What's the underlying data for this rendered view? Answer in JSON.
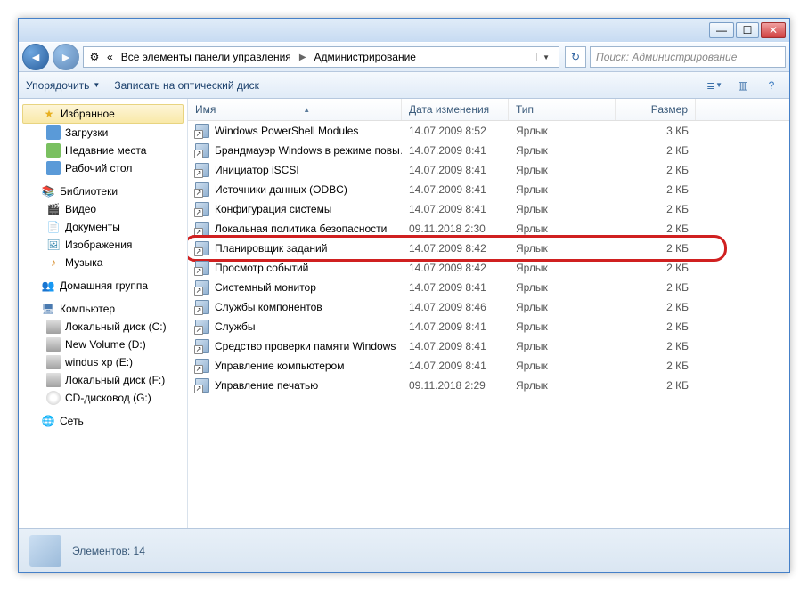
{
  "address": {
    "prefix_icon": "«",
    "seg1": "Все элементы панели управления",
    "seg2": "Администрирование"
  },
  "search": {
    "placeholder": "Поиск: Администрирование"
  },
  "toolbar": {
    "organize": "Упорядочить",
    "burn": "Записать на оптический диск"
  },
  "columns": {
    "name": "Имя",
    "date": "Дата изменения",
    "type": "Тип",
    "size": "Размер"
  },
  "sidebar": {
    "favorites": {
      "label": "Избранное",
      "items": [
        "Загрузки",
        "Недавние места",
        "Рабочий стол"
      ]
    },
    "libraries": {
      "label": "Библиотеки",
      "items": [
        "Видео",
        "Документы",
        "Изображения",
        "Музыка"
      ]
    },
    "homegroup": {
      "label": "Домашняя группа"
    },
    "computer": {
      "label": "Компьютер",
      "items": [
        "Локальный диск (C:)",
        "New Volume (D:)",
        "windus xp (E:)",
        "Локальный диск (F:)",
        "CD-дисковод (G:)"
      ]
    },
    "network": {
      "label": "Сеть"
    }
  },
  "files": [
    {
      "name": "Windows PowerShell Modules",
      "date": "14.07.2009 8:52",
      "type": "Ярлык",
      "size": "3 КБ"
    },
    {
      "name": "Брандмауэр Windows в режиме повы…",
      "date": "14.07.2009 8:41",
      "type": "Ярлык",
      "size": "2 КБ"
    },
    {
      "name": "Инициатор iSCSI",
      "date": "14.07.2009 8:41",
      "type": "Ярлык",
      "size": "2 КБ"
    },
    {
      "name": "Источники данных (ODBC)",
      "date": "14.07.2009 8:41",
      "type": "Ярлык",
      "size": "2 КБ"
    },
    {
      "name": "Конфигурация системы",
      "date": "14.07.2009 8:41",
      "type": "Ярлык",
      "size": "2 КБ"
    },
    {
      "name": "Локальная политика безопасности",
      "date": "09.11.2018 2:30",
      "type": "Ярлык",
      "size": "2 КБ"
    },
    {
      "name": "Планировщик заданий",
      "date": "14.07.2009 8:42",
      "type": "Ярлык",
      "size": "2 КБ",
      "hilite": true
    },
    {
      "name": "Просмотр событий",
      "date": "14.07.2009 8:42",
      "type": "Ярлык",
      "size": "2 КБ"
    },
    {
      "name": "Системный монитор",
      "date": "14.07.2009 8:41",
      "type": "Ярлык",
      "size": "2 КБ"
    },
    {
      "name": "Службы компонентов",
      "date": "14.07.2009 8:46",
      "type": "Ярлык",
      "size": "2 КБ"
    },
    {
      "name": "Службы",
      "date": "14.07.2009 8:41",
      "type": "Ярлык",
      "size": "2 КБ"
    },
    {
      "name": "Средство проверки памяти Windows",
      "date": "14.07.2009 8:41",
      "type": "Ярлык",
      "size": "2 КБ"
    },
    {
      "name": "Управление компьютером",
      "date": "14.07.2009 8:41",
      "type": "Ярлык",
      "size": "2 КБ"
    },
    {
      "name": "Управление печатью",
      "date": "09.11.2018 2:29",
      "type": "Ярлык",
      "size": "2 КБ"
    }
  ],
  "status": {
    "text": "Элементов: 14"
  }
}
